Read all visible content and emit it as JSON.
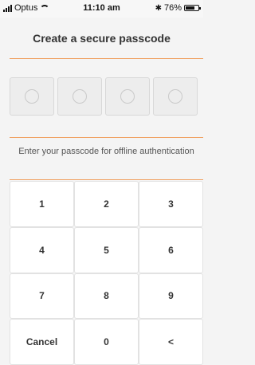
{
  "status_bar": {
    "carrier": "Optus",
    "time": "11:10 am",
    "battery_percent": "76%",
    "battery_level": 0.76
  },
  "screen": {
    "title": "Create a secure passcode",
    "instruction": "Enter your passcode for offline authentication",
    "passcode_slots": 4
  },
  "keypad": {
    "keys": [
      "1",
      "2",
      "3",
      "4",
      "5",
      "6",
      "7",
      "8",
      "9",
      "Cancel",
      "0",
      "<"
    ]
  },
  "colors": {
    "accent": "#f0a060",
    "background": "#f4f4f4"
  },
  "icons": [
    "signal-icon",
    "wifi-icon",
    "bluetooth-icon",
    "battery-icon"
  ]
}
